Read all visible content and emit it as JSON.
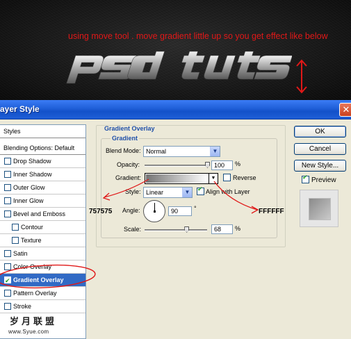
{
  "banner": {
    "instruction": "using move tool . move gradient little up so you get effect like below",
    "logo_text": "psd tuts"
  },
  "dialog": {
    "title": "ayer Style",
    "close_glyph": "✕"
  },
  "styles_list": {
    "header": "Styles",
    "blending": "Blending Options: Default",
    "items": [
      {
        "label": "Drop Shadow",
        "checked": false
      },
      {
        "label": "Inner Shadow",
        "checked": false
      },
      {
        "label": "Outer Glow",
        "checked": false
      },
      {
        "label": "Inner Glow",
        "checked": false
      },
      {
        "label": "Bevel and Emboss",
        "checked": false
      },
      {
        "label": "Contour",
        "checked": false
      },
      {
        "label": "Texture",
        "checked": false
      },
      {
        "label": "Satin",
        "checked": false
      },
      {
        "label": "Color Overlay",
        "checked": false
      },
      {
        "label": "Gradient Overlay",
        "checked": true,
        "selected": true
      },
      {
        "label": "Pattern Overlay",
        "checked": false
      },
      {
        "label": "Stroke",
        "checked": false
      }
    ]
  },
  "gradient_overlay": {
    "section_title": "Gradient Overlay",
    "group_title": "Gradient",
    "blend_mode_label": "Blend Mode:",
    "blend_mode_value": "Normal",
    "opacity_label": "Opacity:",
    "opacity_value": "100",
    "opacity_level": 1.0,
    "percent": "%",
    "gradient_label": "Gradient:",
    "reverse_label": "Reverse",
    "reverse_checked": false,
    "style_label": "Style:",
    "style_value": "Linear",
    "align_label": "Align with Layer",
    "align_checked": true,
    "angle_label": "Angle:",
    "angle_value": "90",
    "degree": "°",
    "scale_label": "Scale:",
    "scale_value": "68",
    "scale_level": 0.68
  },
  "annotations": {
    "left_color": "757575",
    "right_color": "FFFFFF",
    "accent": "#e01818"
  },
  "buttons": {
    "ok": "OK",
    "cancel": "Cancel",
    "new_style": "New Style...",
    "preview_label": "Preview",
    "preview_checked": true
  },
  "watermark": {
    "cn": "岁月联盟",
    "url": "www.Syue.com"
  },
  "colors": {
    "titlebar": "#1f5fd8",
    "selection": "#316ac5",
    "group_title": "#1f4fa8",
    "gradient_start": "#757575",
    "gradient_end": "#ffffff"
  }
}
